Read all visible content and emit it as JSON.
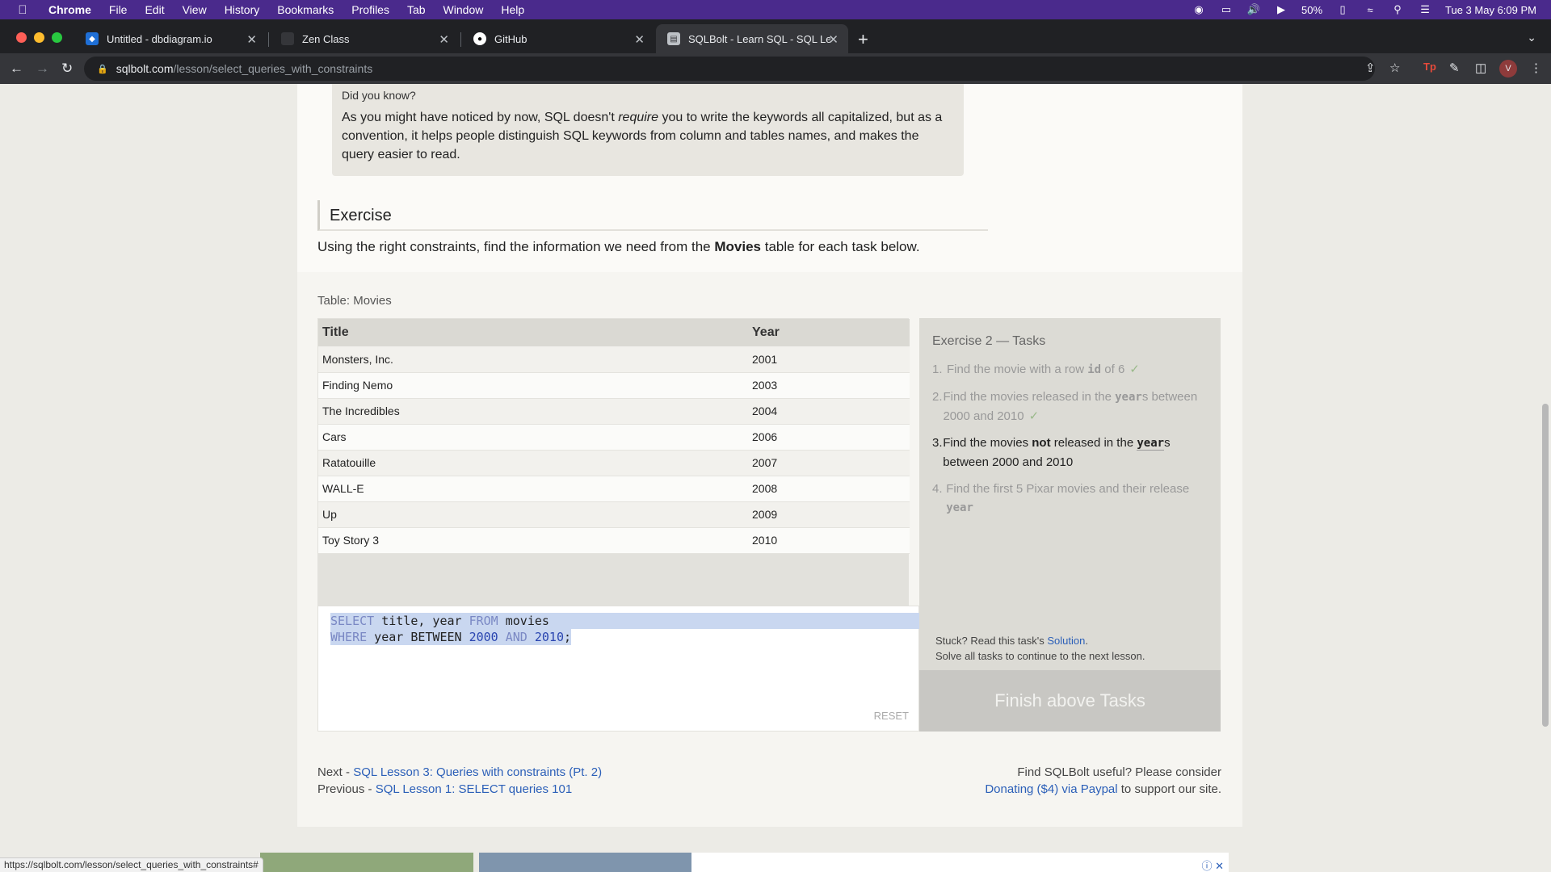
{
  "menubar": {
    "items": [
      "Chrome",
      "File",
      "Edit",
      "View",
      "History",
      "Bookmarks",
      "Profiles",
      "Tab",
      "Window",
      "Help"
    ],
    "battery": "50%",
    "datetime": "Tue 3 May  6:09 PM"
  },
  "tabs": [
    {
      "title": "Untitled - dbdiagram.io"
    },
    {
      "title": "Zen Class"
    },
    {
      "title": "GitHub"
    },
    {
      "title": "SQLBolt - Learn SQL - SQL Les"
    }
  ],
  "toolbar": {
    "url_host": "sqlbolt.com",
    "url_path": "/lesson/select_queries_with_constraints",
    "avatar": "V"
  },
  "didyouknow": {
    "heading": "Did you know?",
    "text_before": "As you might have noticed by now, SQL doesn't ",
    "emphasis": "require",
    "text_after": " you to write the keywords all capitalized, but as a convention, it helps people distinguish SQL keywords from column and tables names, and makes the query easier to read."
  },
  "exercise": {
    "heading": "Exercise",
    "text_before": "Using the right constraints, find the information we need from the ",
    "table_name": "Movies",
    "text_after": " table for each task below."
  },
  "table": {
    "label_prefix": "Table: ",
    "label_name": "Movies",
    "columns": [
      "Title",
      "Year"
    ],
    "rows": [
      [
        "Monsters, Inc.",
        "2001"
      ],
      [
        "Finding Nemo",
        "2003"
      ],
      [
        "The Incredibles",
        "2004"
      ],
      [
        "Cars",
        "2006"
      ],
      [
        "Ratatouille",
        "2007"
      ],
      [
        "WALL-E",
        "2008"
      ],
      [
        "Up",
        "2009"
      ],
      [
        "Toy Story 3",
        "2010"
      ]
    ]
  },
  "editor": {
    "line1": {
      "kw1": "SELECT",
      "mid": " title, year ",
      "kw2": "FROM",
      "end": " movies"
    },
    "line2": {
      "kw1": "WHERE",
      "mid1": " year BETWEEN ",
      "n1": "2000",
      "sp1": " ",
      "kw2": "AND",
      "sp2": " ",
      "n2": "2010",
      "end": ";"
    },
    "reset": "RESET"
  },
  "tasks": {
    "heading": "Exercise 2 — Tasks",
    "items": [
      {
        "num": "1.",
        "pre": "Find the movie with a row ",
        "code": "id",
        "post": " of 6",
        "check": "✓"
      },
      {
        "num": "2.",
        "pre": "Find the movies released in the ",
        "code": "year",
        "post": "s between 2000 and 2010",
        "check": "✓"
      },
      {
        "num": "3.",
        "pre": "Find the movies ",
        "bold": "not",
        "mid": " released in the ",
        "code": "year",
        "post": "s between 2000 and 2010"
      },
      {
        "num": "4.",
        "pre": "Find the first 5 Pixar movies and their release ",
        "code": "year"
      }
    ],
    "stuck_pre": "Stuck? Read this task's ",
    "stuck_link": "Solution",
    "stuck_post": ".",
    "solve_all": "Solve all tasks to continue to the next lesson.",
    "finish": "Finish above Tasks"
  },
  "footer": {
    "next_prefix": "Next - ",
    "next_link": "SQL Lesson 3: Queries with constraints (Pt. 2)",
    "prev_prefix": "Previous - ",
    "prev_link": "SQL Lesson 1: SELECT queries 101",
    "donate_line1": "Find SQLBolt useful? Please consider",
    "donate_link": "Donating ($4) via Paypal",
    "donate_post": " to support our site."
  },
  "status_url": "https://sqlbolt.com/lesson/select_queries_with_constraints#"
}
